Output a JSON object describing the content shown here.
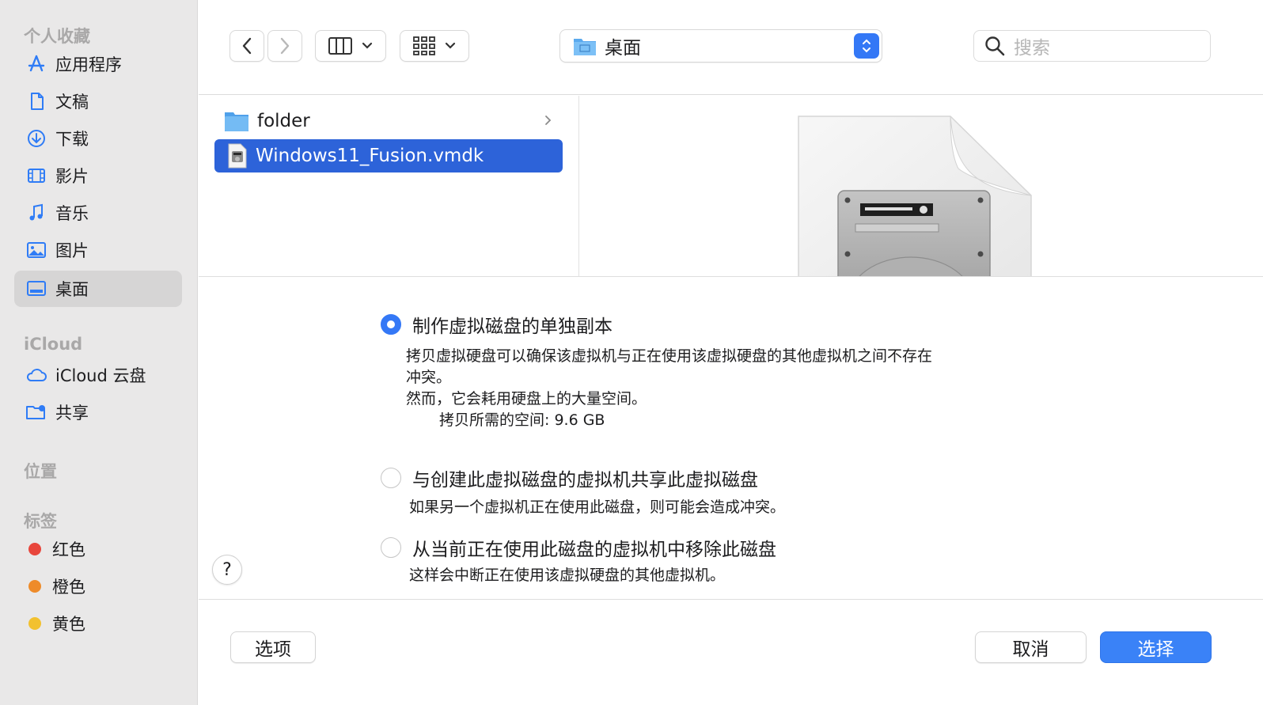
{
  "sidebar": {
    "favorites_title": "个人收藏",
    "favorites": [
      {
        "label": "应用程序",
        "icon": "applications-icon"
      },
      {
        "label": "文稿",
        "icon": "document-icon"
      },
      {
        "label": "下载",
        "icon": "download-icon"
      },
      {
        "label": "影片",
        "icon": "film-icon"
      },
      {
        "label": "音乐",
        "icon": "music-icon"
      },
      {
        "label": "图片",
        "icon": "photo-icon"
      },
      {
        "label": "桌面",
        "icon": "desktop-icon",
        "active": true
      }
    ],
    "icloud_title": "iCloud",
    "icloud": [
      {
        "label": "iCloud 云盘",
        "icon": "cloud-icon"
      },
      {
        "label": "共享",
        "icon": "shared-folder-icon"
      }
    ],
    "locations_title": "位置",
    "tags_title": "标签",
    "tags": [
      {
        "label": "红色",
        "color": "#e8463c"
      },
      {
        "label": "橙色",
        "color": "#ee8b2a"
      },
      {
        "label": "黄色",
        "color": "#f2c12f"
      }
    ]
  },
  "toolbar": {
    "path": "桌面",
    "search_placeholder": "搜索"
  },
  "files": [
    {
      "name": "folder",
      "type": "folder",
      "selected": false
    },
    {
      "name": "Windows11_Fusion.vmdk",
      "type": "vmdk",
      "selected": true
    }
  ],
  "options": [
    {
      "label": "制作虚拟磁盘的单独副本",
      "selected": true
    },
    {
      "label": "与创建此虚拟磁盘的虚拟机共享此虚拟磁盘",
      "selected": false
    },
    {
      "label": "从当前正在使用此磁盘的虚拟机中移除此磁盘",
      "selected": false
    }
  ],
  "descriptions": {
    "copy_line1": "拷贝虚拟硬盘可以确保该虚拟机与正在使用该虚拟硬盘的其他虚拟机之间不存在",
    "copy_line2": "冲突。",
    "copy_line3": "然而，它会耗用硬盘上的大量空间。",
    "copy_space": "拷贝所需的空间: 9.6 GB",
    "share": "如果另一个虚拟机正在使用此磁盘，则可能会造成冲突。",
    "remove": "这样会中断正在使用该虚拟硬盘的其他虚拟机。"
  },
  "help_label": "?",
  "buttons": {
    "options": "选项",
    "cancel": "取消",
    "choose": "选择"
  },
  "colors": {
    "accent": "#3478f6",
    "selection": "#2d63d9",
    "sidebar_bg": "#e9e8e8"
  }
}
